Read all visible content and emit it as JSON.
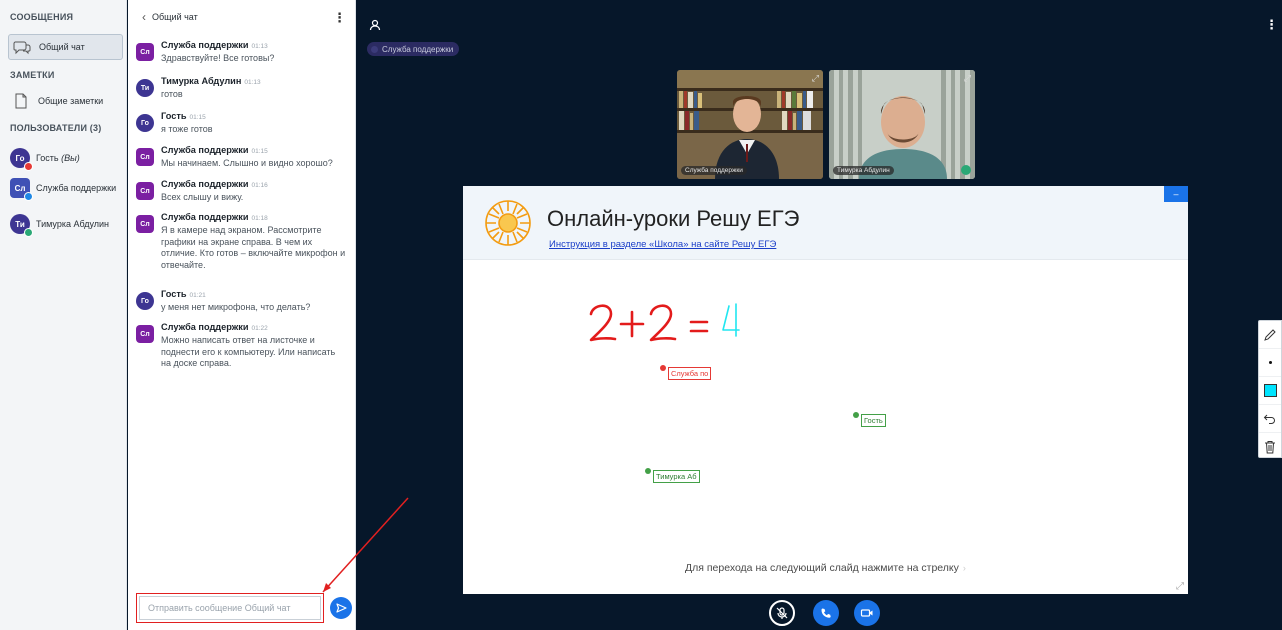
{
  "sidebar": {
    "messages_title": "СООБЩЕНИЯ",
    "public_chat_label": "Общий чат",
    "notes_title": "ЗАМЕТКИ",
    "shared_notes_label": "Общие заметки",
    "users_title": "ПОЛЬЗОВАТЕЛИ (3)",
    "users": [
      {
        "initials": "Го",
        "name": "Гость",
        "suffix": "(Вы)"
      },
      {
        "initials": "Сл",
        "name": "Служба поддержки",
        "suffix": ""
      },
      {
        "initials": "Ти",
        "name": "Тимурка Абдулин",
        "suffix": ""
      }
    ]
  },
  "chat": {
    "title": "Общий чат",
    "input_placeholder": "Отправить сообщение Общий чат",
    "messages": [
      {
        "initials": "Сл",
        "author": "Служба поддержки",
        "time": "01:13",
        "lines": [
          "Здравствуйте! Все готовы?"
        ]
      },
      {
        "initials": "Ти",
        "author": "Тимурка Абдулин",
        "time": "01:13",
        "lines": [
          "готов"
        ]
      },
      {
        "initials": "Го",
        "author": "Гость",
        "time": "01:15",
        "lines": [
          "я тоже готов"
        ]
      },
      {
        "initials": "Сл",
        "author": "Служба поддержки",
        "time": "01:15",
        "lines": [
          "Мы начинаем. Слышно и видно хорошо?"
        ]
      },
      {
        "initials": "Сл",
        "author": "Служба поддержки",
        "time": "01:16",
        "lines": [
          "Всех слышу и вижу."
        ]
      },
      {
        "initials": "Сл",
        "author": "Служба поддержки",
        "time": "01:18",
        "lines": [
          "Я в камере над экраном. Рассмотрите",
          "графики на экране справа. В чем их",
          "отличие. Кто готов – включайте микрофон и",
          "отвечайте."
        ]
      },
      {
        "initials": "Го",
        "author": "Гость",
        "time": "01:21",
        "lines": [
          "у меня нет микрофона, что делать?"
        ]
      },
      {
        "initials": "Сл",
        "author": "Служба поддержки",
        "time": "01:22",
        "lines": [
          "Можно написать ответ на листочке и",
          "поднести его к компьютеру. Или написать",
          "на доске справа."
        ]
      }
    ]
  },
  "main": {
    "presenter_label": "Служба поддержки",
    "videos": [
      {
        "name": "Служба поддержки"
      },
      {
        "name": "Тимурка Абдулин"
      }
    ],
    "slide": {
      "title": "Онлайн-уроки Решу ЕГЭ",
      "link": "Инструкция в разделе «Школа» на сайте Решу ЕГЭ",
      "footer": "Для перехода на следующий слайд нажмите на стрелку",
      "minimize_glyph": "–",
      "handwriting_red": "2+2 =",
      "handwriting_cyan": "4",
      "cursors": [
        {
          "label": "Служба по",
          "color": "#e53935"
        },
        {
          "label": "Гость",
          "color": "#43a047"
        },
        {
          "label": "Тимурка Аб",
          "color": "#43a047"
        }
      ]
    },
    "colors": {
      "background": "#06172a",
      "accent": "#1a73e8",
      "highlight_red": "#e12020",
      "pen_color": "#00e5ff"
    }
  }
}
